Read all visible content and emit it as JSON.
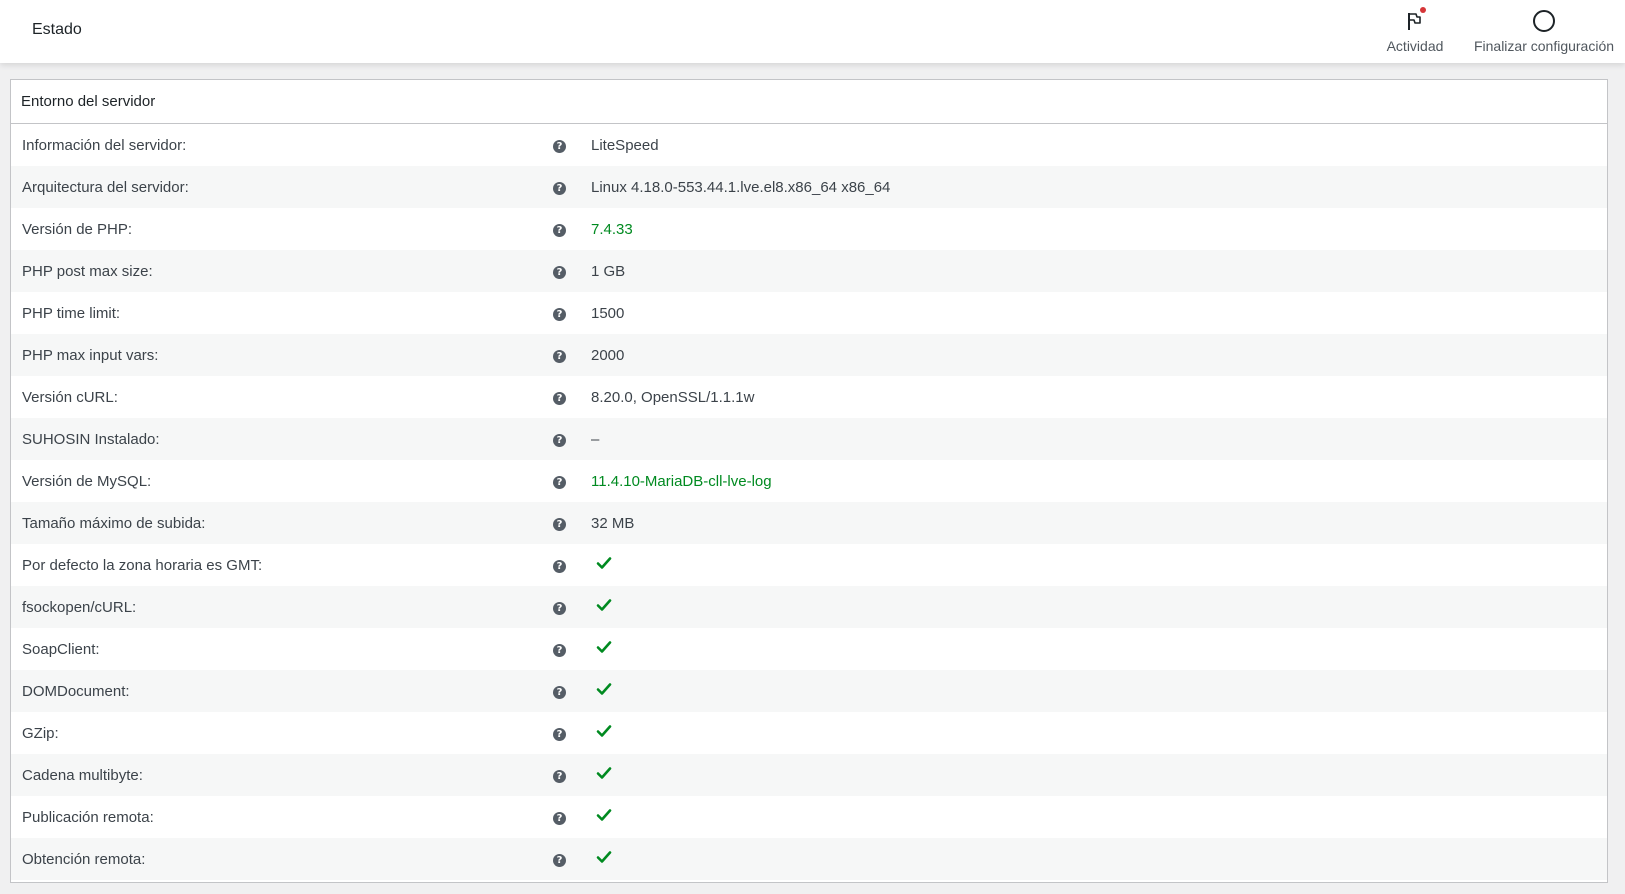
{
  "header": {
    "title": "Estado",
    "activity_label": "Actividad",
    "setup_label": "Finalizar configuración",
    "badge_color": "#d63638"
  },
  "panel": {
    "title": "Entorno del servidor",
    "rows": [
      {
        "label": "Información del servidor:",
        "value": "LiteSpeed",
        "kind": "text"
      },
      {
        "label": "Arquitectura del servidor:",
        "value": "Linux 4.18.0-553.44.1.lve.el8.x86_64 x86_64",
        "kind": "text"
      },
      {
        "label": "Versión de PHP:",
        "value": "7.4.33",
        "kind": "ok"
      },
      {
        "label": "PHP post max size:",
        "value": "1 GB",
        "kind": "text"
      },
      {
        "label": "PHP time limit:",
        "value": "1500",
        "kind": "text"
      },
      {
        "label": "PHP max input vars:",
        "value": "2000",
        "kind": "text"
      },
      {
        "label": "Versión cURL:",
        "value": "8.20.0, OpenSSL/1.1.1w",
        "kind": "text"
      },
      {
        "label": "SUHOSIN Instalado:",
        "value": "–",
        "kind": "text"
      },
      {
        "label": "Versión de MySQL:",
        "value": "11.4.10-MariaDB-cll-lve-log",
        "kind": "ok"
      },
      {
        "label": "Tamaño máximo de subida:",
        "value": "32 MB",
        "kind": "text"
      },
      {
        "label": "Por defecto la zona horaria es GMT:",
        "value": "",
        "kind": "check"
      },
      {
        "label": "fsockopen/cURL:",
        "value": "",
        "kind": "check"
      },
      {
        "label": "SoapClient:",
        "value": "",
        "kind": "check"
      },
      {
        "label": "DOMDocument:",
        "value": "",
        "kind": "check"
      },
      {
        "label": "GZip:",
        "value": "",
        "kind": "check"
      },
      {
        "label": "Cadena multibyte:",
        "value": "",
        "kind": "check"
      },
      {
        "label": "Publicación remota:",
        "value": "",
        "kind": "check"
      },
      {
        "label": "Obtención remota:",
        "value": "",
        "kind": "check"
      }
    ]
  },
  "icons": {
    "help": "help-icon",
    "check": "check-icon",
    "flag": "flag-icon",
    "progress": "progress-ring-icon"
  },
  "colors": {
    "ok": "#008a20",
    "help_bg": "#555d66"
  }
}
